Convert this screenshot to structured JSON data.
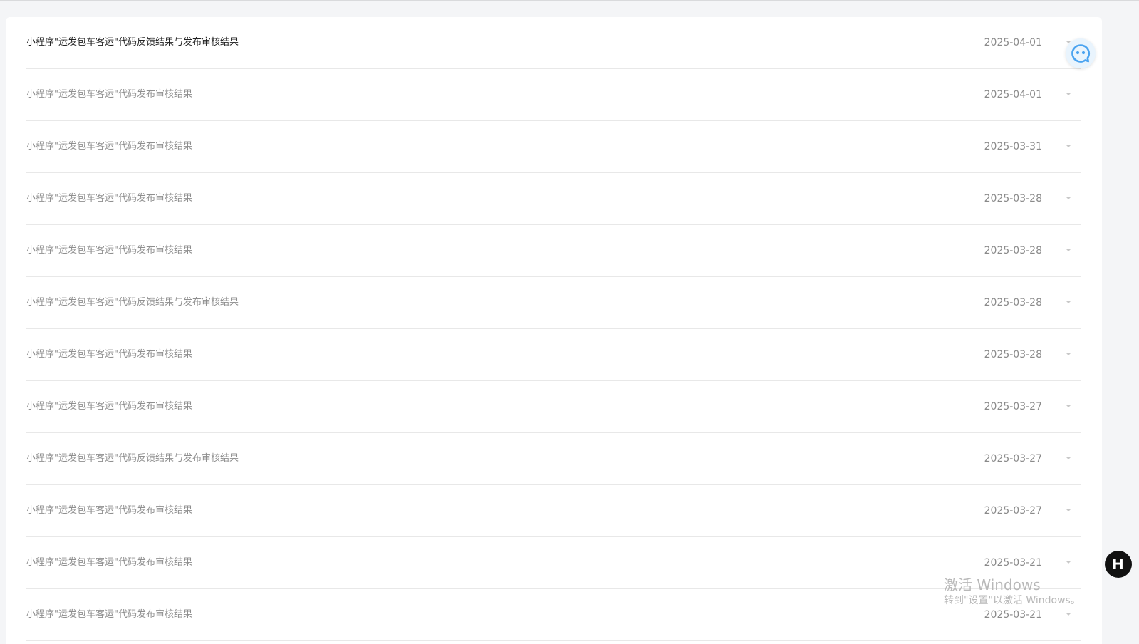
{
  "messages": [
    {
      "title": "小程序\"运发包车客运\"代码反馈结果与发布审核结果",
      "date": "2025-04-01",
      "unread": true
    },
    {
      "title": "小程序\"运发包车客运\"代码发布审核结果",
      "date": "2025-04-01",
      "unread": false
    },
    {
      "title": "小程序\"运发包车客运\"代码发布审核结果",
      "date": "2025-03-31",
      "unread": false
    },
    {
      "title": "小程序\"运发包车客运\"代码发布审核结果",
      "date": "2025-03-28",
      "unread": false
    },
    {
      "title": "小程序\"运发包车客运\"代码发布审核结果",
      "date": "2025-03-28",
      "unread": false
    },
    {
      "title": "小程序\"运发包车客运\"代码反馈结果与发布审核结果",
      "date": "2025-03-28",
      "unread": false
    },
    {
      "title": "小程序\"运发包车客运\"代码发布审核结果",
      "date": "2025-03-28",
      "unread": false
    },
    {
      "title": "小程序\"运发包车客运\"代码发布审核结果",
      "date": "2025-03-27",
      "unread": false
    },
    {
      "title": "小程序\"运发包车客运\"代码反馈结果与发布审核结果",
      "date": "2025-03-27",
      "unread": false
    },
    {
      "title": "小程序\"运发包车客运\"代码发布审核结果",
      "date": "2025-03-27",
      "unread": false
    },
    {
      "title": "小程序\"运发包车客运\"代码发布审核结果",
      "date": "2025-03-21",
      "unread": false
    },
    {
      "title": "小程序\"运发包车客运\"代码发布审核结果",
      "date": "2025-03-21",
      "unread": false
    }
  ],
  "icons": {
    "row_toggle": "chevron-down-icon",
    "chat": "chat-bubble-icon",
    "side": "floating-widget-icon"
  },
  "side_fab": {
    "letter": "H"
  },
  "watermark": {
    "title": "激活 Windows",
    "subtitle": "转到\"设置\"以激活 Windows。"
  },
  "colors": {
    "accent": "#4aa3f0",
    "unread_text": "#222222",
    "read_text": "#8f8f8f",
    "divider": "#e8e8e8"
  }
}
